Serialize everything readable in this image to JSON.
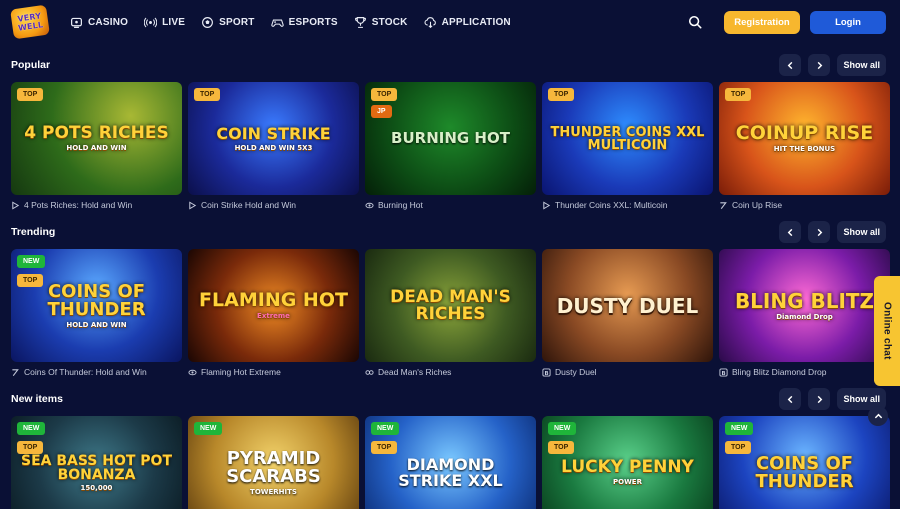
{
  "logo": {
    "line1": "VERY",
    "line2": "WELL"
  },
  "nav": [
    {
      "label": "CASINO",
      "icon": "casino-icon"
    },
    {
      "label": "LIVE",
      "icon": "live-icon"
    },
    {
      "label": "SPORT",
      "icon": "sport-icon"
    },
    {
      "label": "ESPORTS",
      "icon": "esports-icon"
    },
    {
      "label": "STOCK",
      "icon": "stock-icon"
    },
    {
      "label": "APPLICATION",
      "icon": "application-icon"
    }
  ],
  "header": {
    "registration_label": "Registration",
    "login_label": "Login"
  },
  "colors": {
    "background": "#0a1035",
    "registration": "#f7b72e",
    "login": "#1f5ad8",
    "chat": "#f7c531"
  },
  "sections": [
    {
      "title": "Popular",
      "show_all": "Show all",
      "games": [
        {
          "art": "4 POTS RICHES",
          "art_sub": "HOLD AND WIN",
          "badges": [
            "TOP"
          ],
          "name": "4 Pots Riches: Hold and Win"
        },
        {
          "art": "COIN STRIKE",
          "art_sub": "HOLD AND WIN 5X3",
          "badges": [
            "TOP"
          ],
          "name": "Coin Strike Hold and Win"
        },
        {
          "art": "BURNING HOT",
          "art_sub": "",
          "badges": [
            "TOP",
            "JP"
          ],
          "name": "Burning Hot"
        },
        {
          "art": "THUNDER COINS XXL MULTICOIN",
          "art_sub": "",
          "badges": [
            "TOP"
          ],
          "name": "Thunder Coins XXL: Multicoin"
        },
        {
          "art": "COINUP RISE",
          "art_sub": "HIT THE BONUS",
          "badges": [
            "TOP"
          ],
          "name": "Coin Up Rise"
        }
      ]
    },
    {
      "title": "Trending",
      "show_all": "Show all",
      "games": [
        {
          "art": "COINS OF THUNDER",
          "art_sub": "HOLD AND WIN",
          "badges": [
            "NEW",
            "TOP"
          ],
          "name": "Coins Of Thunder: Hold and Win"
        },
        {
          "art": "FLAMING HOT",
          "art_sub": "Extreme",
          "badges": [],
          "name": "Flaming Hot Extreme"
        },
        {
          "art": "DEAD MAN'S RICHES",
          "art_sub": "",
          "badges": [],
          "name": "Dead Man's Riches"
        },
        {
          "art": "DUSTY DUEL",
          "art_sub": "",
          "badges": [],
          "name": "Dusty Duel"
        },
        {
          "art": "BLING BLITZ",
          "art_sub": "Diamond Drop",
          "badges": [],
          "name": "Bling Blitz Diamond Drop"
        }
      ]
    },
    {
      "title": "New items",
      "show_all": "Show all",
      "games": [
        {
          "art": "SEA BASS HOT POT BONANZA",
          "art_sub": "150,000",
          "badges": [
            "NEW",
            "TOP"
          ]
        },
        {
          "art": "PYRAMID SCARABS",
          "art_sub": "TOWERHITS",
          "badges": [
            "NEW"
          ]
        },
        {
          "art": "DIAMOND STRIKE XXL",
          "art_sub": "",
          "badges": [
            "NEW",
            "TOP"
          ]
        },
        {
          "art": "LUCKY PENNY",
          "art_sub": "POWER",
          "badges": [
            "NEW",
            "TOP"
          ]
        },
        {
          "art": "COINS OF THUNDER",
          "art_sub": "",
          "badges": [
            "NEW",
            "TOP"
          ]
        }
      ]
    }
  ],
  "chat": {
    "label": "Online chat"
  }
}
